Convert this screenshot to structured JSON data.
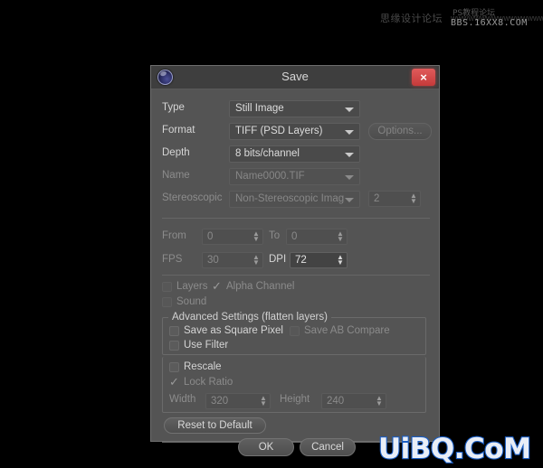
{
  "window": {
    "title": "Save",
    "app_icon": "cinema4d-logo-icon",
    "close_label": "×"
  },
  "fields": {
    "type": {
      "label": "Type",
      "value": "Still Image",
      "enabled": true
    },
    "format": {
      "label": "Format",
      "value": "TIFF (PSD Layers)",
      "enabled": true,
      "options_button": "Options..."
    },
    "depth": {
      "label": "Depth",
      "value": "8 bits/channel",
      "enabled": true
    },
    "name": {
      "label": "Name",
      "value": "Name0000.TIF",
      "enabled": false
    },
    "stereoscopic": {
      "label": "Stereoscopic",
      "value": "Non-Stereoscopic Imag",
      "enabled": false,
      "count": "2"
    },
    "from": {
      "label": "From",
      "value": "0",
      "enabled": false
    },
    "to": {
      "label": "To",
      "value": "0",
      "enabled": false
    },
    "fps": {
      "label": "FPS",
      "value": "30",
      "enabled": false
    },
    "dpi": {
      "label": "DPI",
      "value": "72",
      "enabled": true
    }
  },
  "checkboxes": {
    "layers": {
      "label": "Layers",
      "checked": false,
      "enabled": false
    },
    "alpha_channel": {
      "label": "Alpha Channel",
      "checked": true,
      "enabled": false
    },
    "sound": {
      "label": "Sound",
      "checked": false,
      "enabled": false
    },
    "save_as_square_pixel": {
      "label": "Save as Square Pixel",
      "checked": false,
      "enabled": true
    },
    "save_ab_compare": {
      "label": "Save AB Compare",
      "checked": false,
      "enabled": false
    },
    "use_filter": {
      "label": "Use Filter",
      "checked": false,
      "enabled": true
    },
    "rescale": {
      "label": "Rescale",
      "checked": false,
      "enabled": true
    },
    "lock_ratio": {
      "label": "Lock Ratio",
      "checked": true,
      "enabled": false
    }
  },
  "advanced_group": {
    "title": "Advanced Settings (flatten layers)",
    "width": {
      "label": "Width",
      "value": "320",
      "enabled": false
    },
    "height": {
      "label": "Height",
      "value": "240",
      "enabled": false
    }
  },
  "buttons": {
    "reset": "Reset to Default",
    "ok": "OK",
    "cancel": "Cancel"
  },
  "watermarks": {
    "top_cn": "思缘设计论坛",
    "top_dots": "wwwwwwwwwwwwwwww",
    "top_cn2": "PS教程论坛",
    "top_bbs": "BBS.16XX8.COM",
    "bottom_logo": "UiBQ.CoM"
  },
  "colors": {
    "dialog_bg": "#545454",
    "titlebar_bg": "#3e3e3e",
    "close_red": "#d44b4b",
    "logo_blue": "#1a5ec4"
  }
}
